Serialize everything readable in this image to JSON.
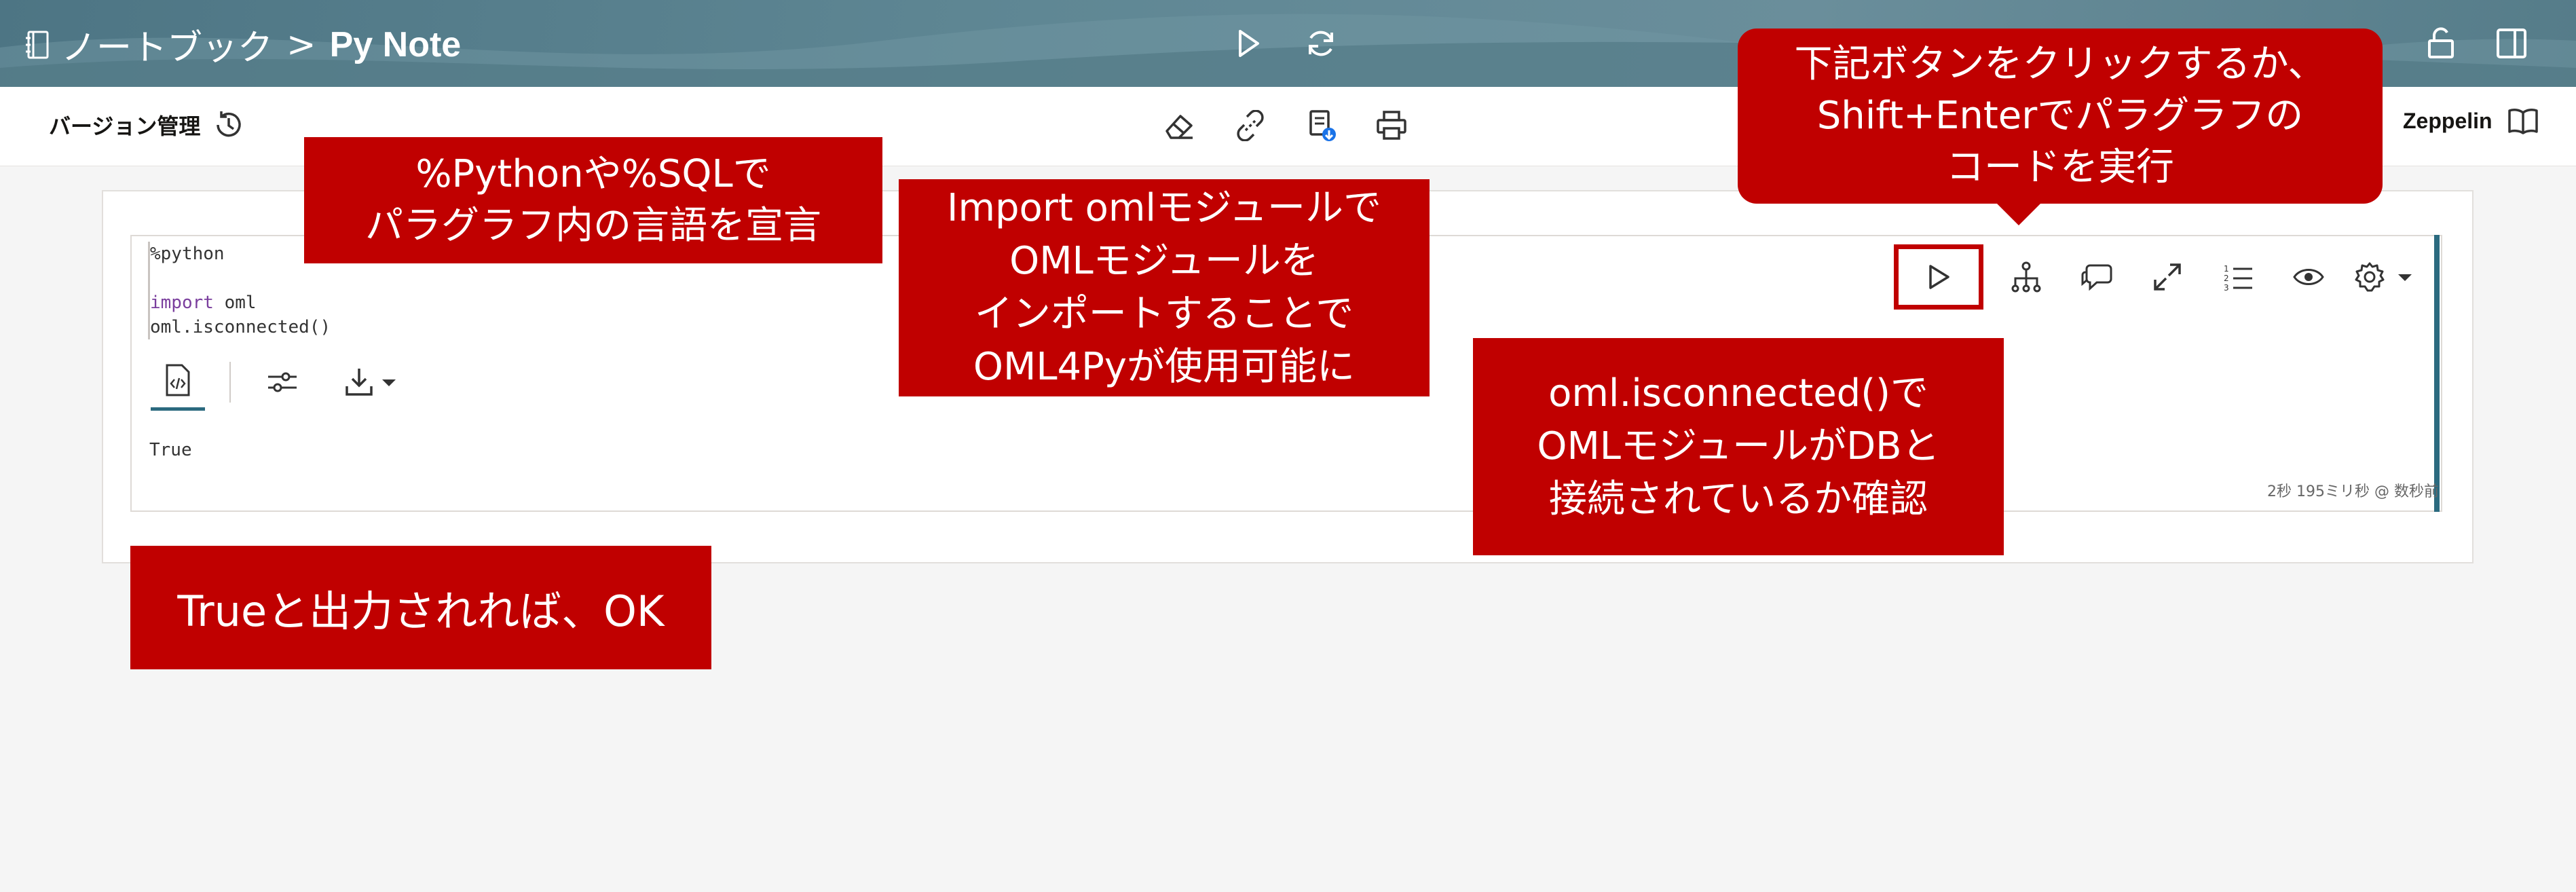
{
  "header": {
    "notebooks_label": "ノートブック",
    "separator": ">",
    "notebook_name": "Py Note"
  },
  "toolbar": {
    "version_label": "バージョン管理",
    "interpreter_label": "Zeppelin"
  },
  "paragraph": {
    "code_lines": [
      "%python",
      "",
      "import",
      "oml",
      "oml.isconnected()"
    ],
    "output": "True",
    "timing": "2秒 195ミリ秒 @ 数秒前"
  },
  "annotations": {
    "lang": "%Pythonや%SQLで\nパラグラフ内の言語を宣言",
    "import": "Import omlモジュールで\nOMLモジュールを\nインポートすることで\nOML4Pyが使用可能に",
    "connected": "oml.isconnected()で\nOMLモジュールがDBと\n接続されているか確認",
    "true_ok": "Trueと出力されれば、OK",
    "run": "下記ボタンをクリックするか、\nShift+Enterでパラグラフの\nコードを実行"
  },
  "colors": {
    "header": "#5f8794",
    "accent": "#2b6a7f",
    "callout": "#c00000"
  }
}
